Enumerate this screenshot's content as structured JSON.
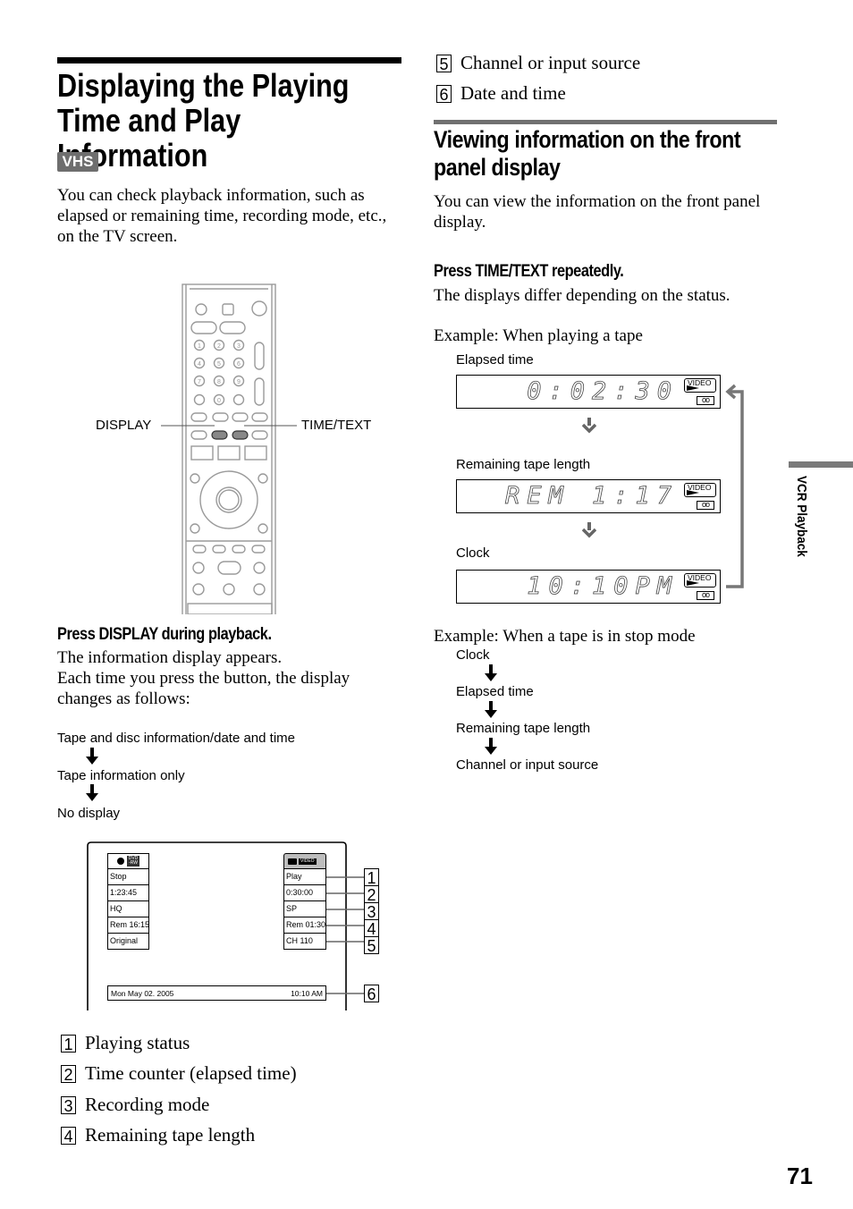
{
  "page": {
    "title": "Displaying the Playing Time and Play Information",
    "badge": "VHS",
    "intro": "You can check playback information, such as elapsed or remaining time, recording mode, etc., on the TV screen.",
    "page_number": "71",
    "side_tab": "VCR Playback"
  },
  "remote": {
    "display_label": "DISPLAY",
    "time_text_label": "TIME/TEXT",
    "number_keys": [
      "1",
      "2",
      "3",
      "4",
      "5",
      "6",
      "7",
      "8",
      "9",
      "0"
    ]
  },
  "step1": {
    "heading": "Press DISPLAY during playback.",
    "body_line1": "The information display appears.",
    "body_line2": "Each time you press the button, the display changes as follows:",
    "flow": [
      "Tape and disc information/date and time",
      "Tape information only",
      "No display"
    ]
  },
  "tv_screen": {
    "disc_icon_label": "DVD\n-RW",
    "disc_rows": [
      "Stop",
      "1:23:45",
      "HQ",
      "Rem 16:15",
      "Original"
    ],
    "tape_icon_label": "VIDEO",
    "tape_rows": [
      "Play",
      "0:30:00",
      "SP",
      "Rem 01:30",
      "CH 110"
    ],
    "date": "Mon May 02. 2005",
    "time": "10:10 AM",
    "callouts": [
      "1",
      "2",
      "3",
      "4",
      "5",
      "6"
    ]
  },
  "legend": [
    {
      "num": "1",
      "text": "Playing status"
    },
    {
      "num": "2",
      "text": "Time counter (elapsed time)"
    },
    {
      "num": "3",
      "text": "Recording mode"
    },
    {
      "num": "4",
      "text": "Remaining tape length"
    },
    {
      "num": "5",
      "text": "Channel or input source"
    },
    {
      "num": "6",
      "text": "Date and time"
    }
  ],
  "section2": {
    "title": "Viewing information on the front panel display",
    "intro": "You can view the information on the front panel display.",
    "step_heading": "Press TIME/TEXT repeatedly.",
    "step_body": "The displays differ depending on the status.",
    "example_playing": "Example: When playing a tape",
    "panels": [
      {
        "label": "Elapsed time",
        "readout": "0:02:30"
      },
      {
        "label": "Remaining tape length",
        "readout": "REM 1:17"
      },
      {
        "label": "Clock",
        "readout": "10:10PM"
      }
    ],
    "panel_badge": "VIDEO",
    "example_stop": "Example: When a tape is in stop mode",
    "stop_flow": [
      "Clock",
      "Elapsed time",
      "Remaining tape length",
      "Channel or input source"
    ]
  }
}
